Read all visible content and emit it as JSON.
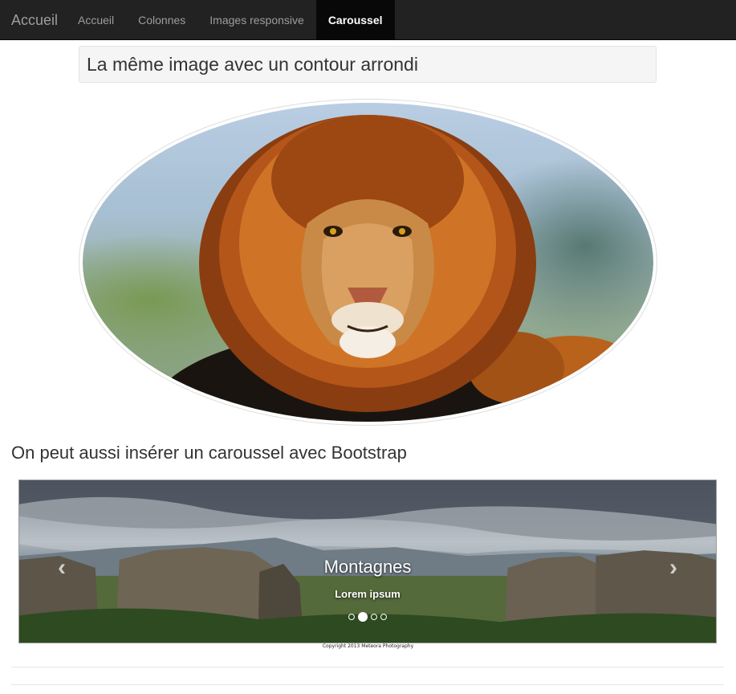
{
  "navbar": {
    "brand": "Accueil",
    "items": [
      {
        "label": "Accueil",
        "active": false
      },
      {
        "label": "Colonnes",
        "active": false
      },
      {
        "label": "Images responsive",
        "active": false
      },
      {
        "label": "Caroussel",
        "active": true
      }
    ]
  },
  "main": {
    "well_title": "La même image avec un contour arrondi",
    "image_subject": "lion",
    "carousel_heading": "On peut aussi insérer un caroussel avec Bootstrap"
  },
  "carousel": {
    "slide_title": "Montagnes",
    "slide_text": "Lorem ipsum",
    "prev_icon": "chevron-left-icon",
    "next_icon": "chevron-right-icon",
    "prev_glyph": "‹",
    "next_glyph": "›",
    "indicator_count": 4,
    "active_index": 1,
    "copyright": "Copyright 2013 Meteora Photography"
  },
  "colors": {
    "navbar_bg": "#222222",
    "navbar_text": "#9d9d9d",
    "navbar_active_bg": "#080808",
    "well_bg": "#f5f5f5"
  }
}
